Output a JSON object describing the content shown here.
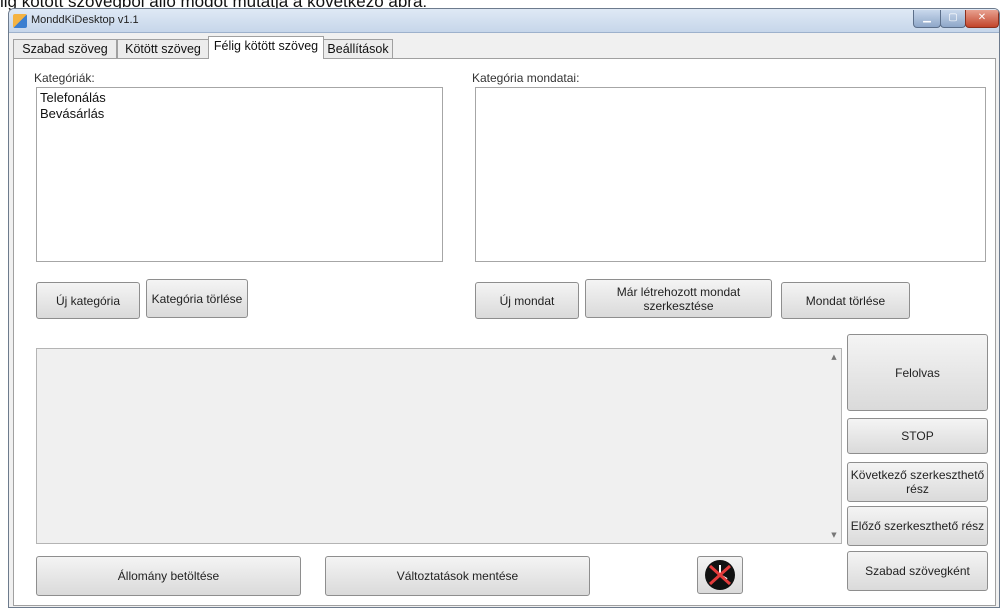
{
  "caption": "lig kötött szövegből álló módot mutatja a következő ábra:",
  "window": {
    "title": "MonddKiDesktop v1.1",
    "icon": "app-icon"
  },
  "tabs": [
    {
      "label": "Szabad szöveg",
      "active": false
    },
    {
      "label": "Kötött szöveg",
      "active": false
    },
    {
      "label": "Félig kötött szöveg",
      "active": true
    },
    {
      "label": "Beállítások",
      "active": false
    }
  ],
  "categories": {
    "label": "Kategóriák:",
    "items": [
      "Telefonálás",
      "Bevásárlás"
    ],
    "new_button": "Új kategória",
    "delete_button": "Kategória törlése"
  },
  "sentences": {
    "label": "Kategória mondatai:",
    "items": [],
    "new_button": "Új mondat",
    "edit_button": "Már létrehozott mondat szerkesztése",
    "delete_button": "Mondat törlése"
  },
  "controls": {
    "read_button": "Felolvas",
    "stop_button": "STOP",
    "next_button": "Következő szerkeszthető rész",
    "prev_button": "Előző szerkeszthető rész",
    "free_text_button": "Szabad szövegként"
  },
  "bottom": {
    "load_button": "Állomány betöltése",
    "save_button": "Változtatások mentése",
    "clock_icon": "clock-disabled-icon"
  },
  "colors": {
    "close": "#c2452b",
    "titlebar": "#c6d6ea"
  }
}
